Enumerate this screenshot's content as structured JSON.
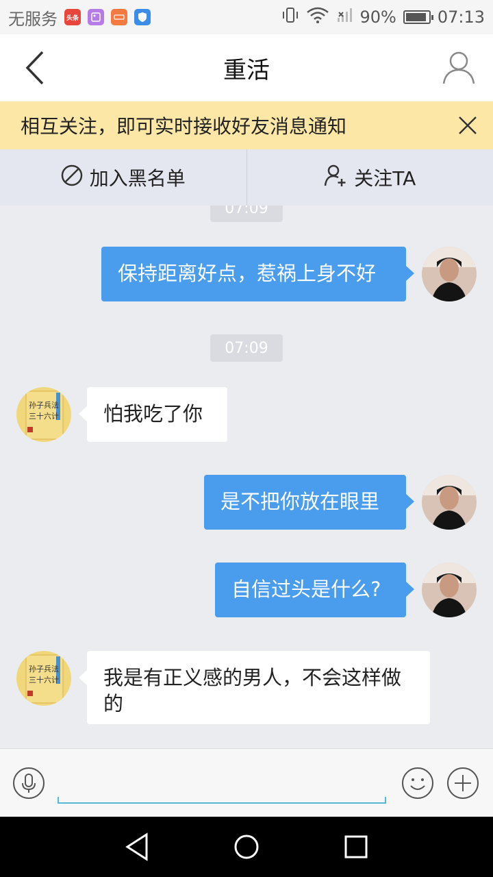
{
  "status_bar": {
    "carrier": "无服务",
    "app_badge_1": "头条",
    "battery_percent": "90%",
    "battery_level": 0.9,
    "time": "07:13"
  },
  "header": {
    "title": "重活"
  },
  "notice": {
    "text": "相互关注，即可实时接收好友消息通知"
  },
  "actions": {
    "blacklist_label": "加入黑名单",
    "follow_label": "关注TA"
  },
  "messages": [
    {
      "type": "timestamp",
      "text": "07:09"
    },
    {
      "type": "outgoing",
      "text": "保持距离好点，惹祸上身不好"
    },
    {
      "type": "timestamp",
      "text": "07:09"
    },
    {
      "type": "incoming",
      "text": "怕我吃了你"
    },
    {
      "type": "outgoing",
      "text": "是不把你放在眼里"
    },
    {
      "type": "outgoing",
      "text": "自信过头是什么?"
    },
    {
      "type": "incoming",
      "text": "我是有正义感的男人，不会这样做的"
    }
  ],
  "contact_avatar_text": "孙子兵法 三十六计",
  "input": {
    "placeholder": ""
  },
  "colors": {
    "outgoing_bubble": "#4a9cec",
    "notice_bg": "#fde7a7",
    "action_bar_bg": "#e4e7f0",
    "chat_bg": "#ebecf0"
  }
}
